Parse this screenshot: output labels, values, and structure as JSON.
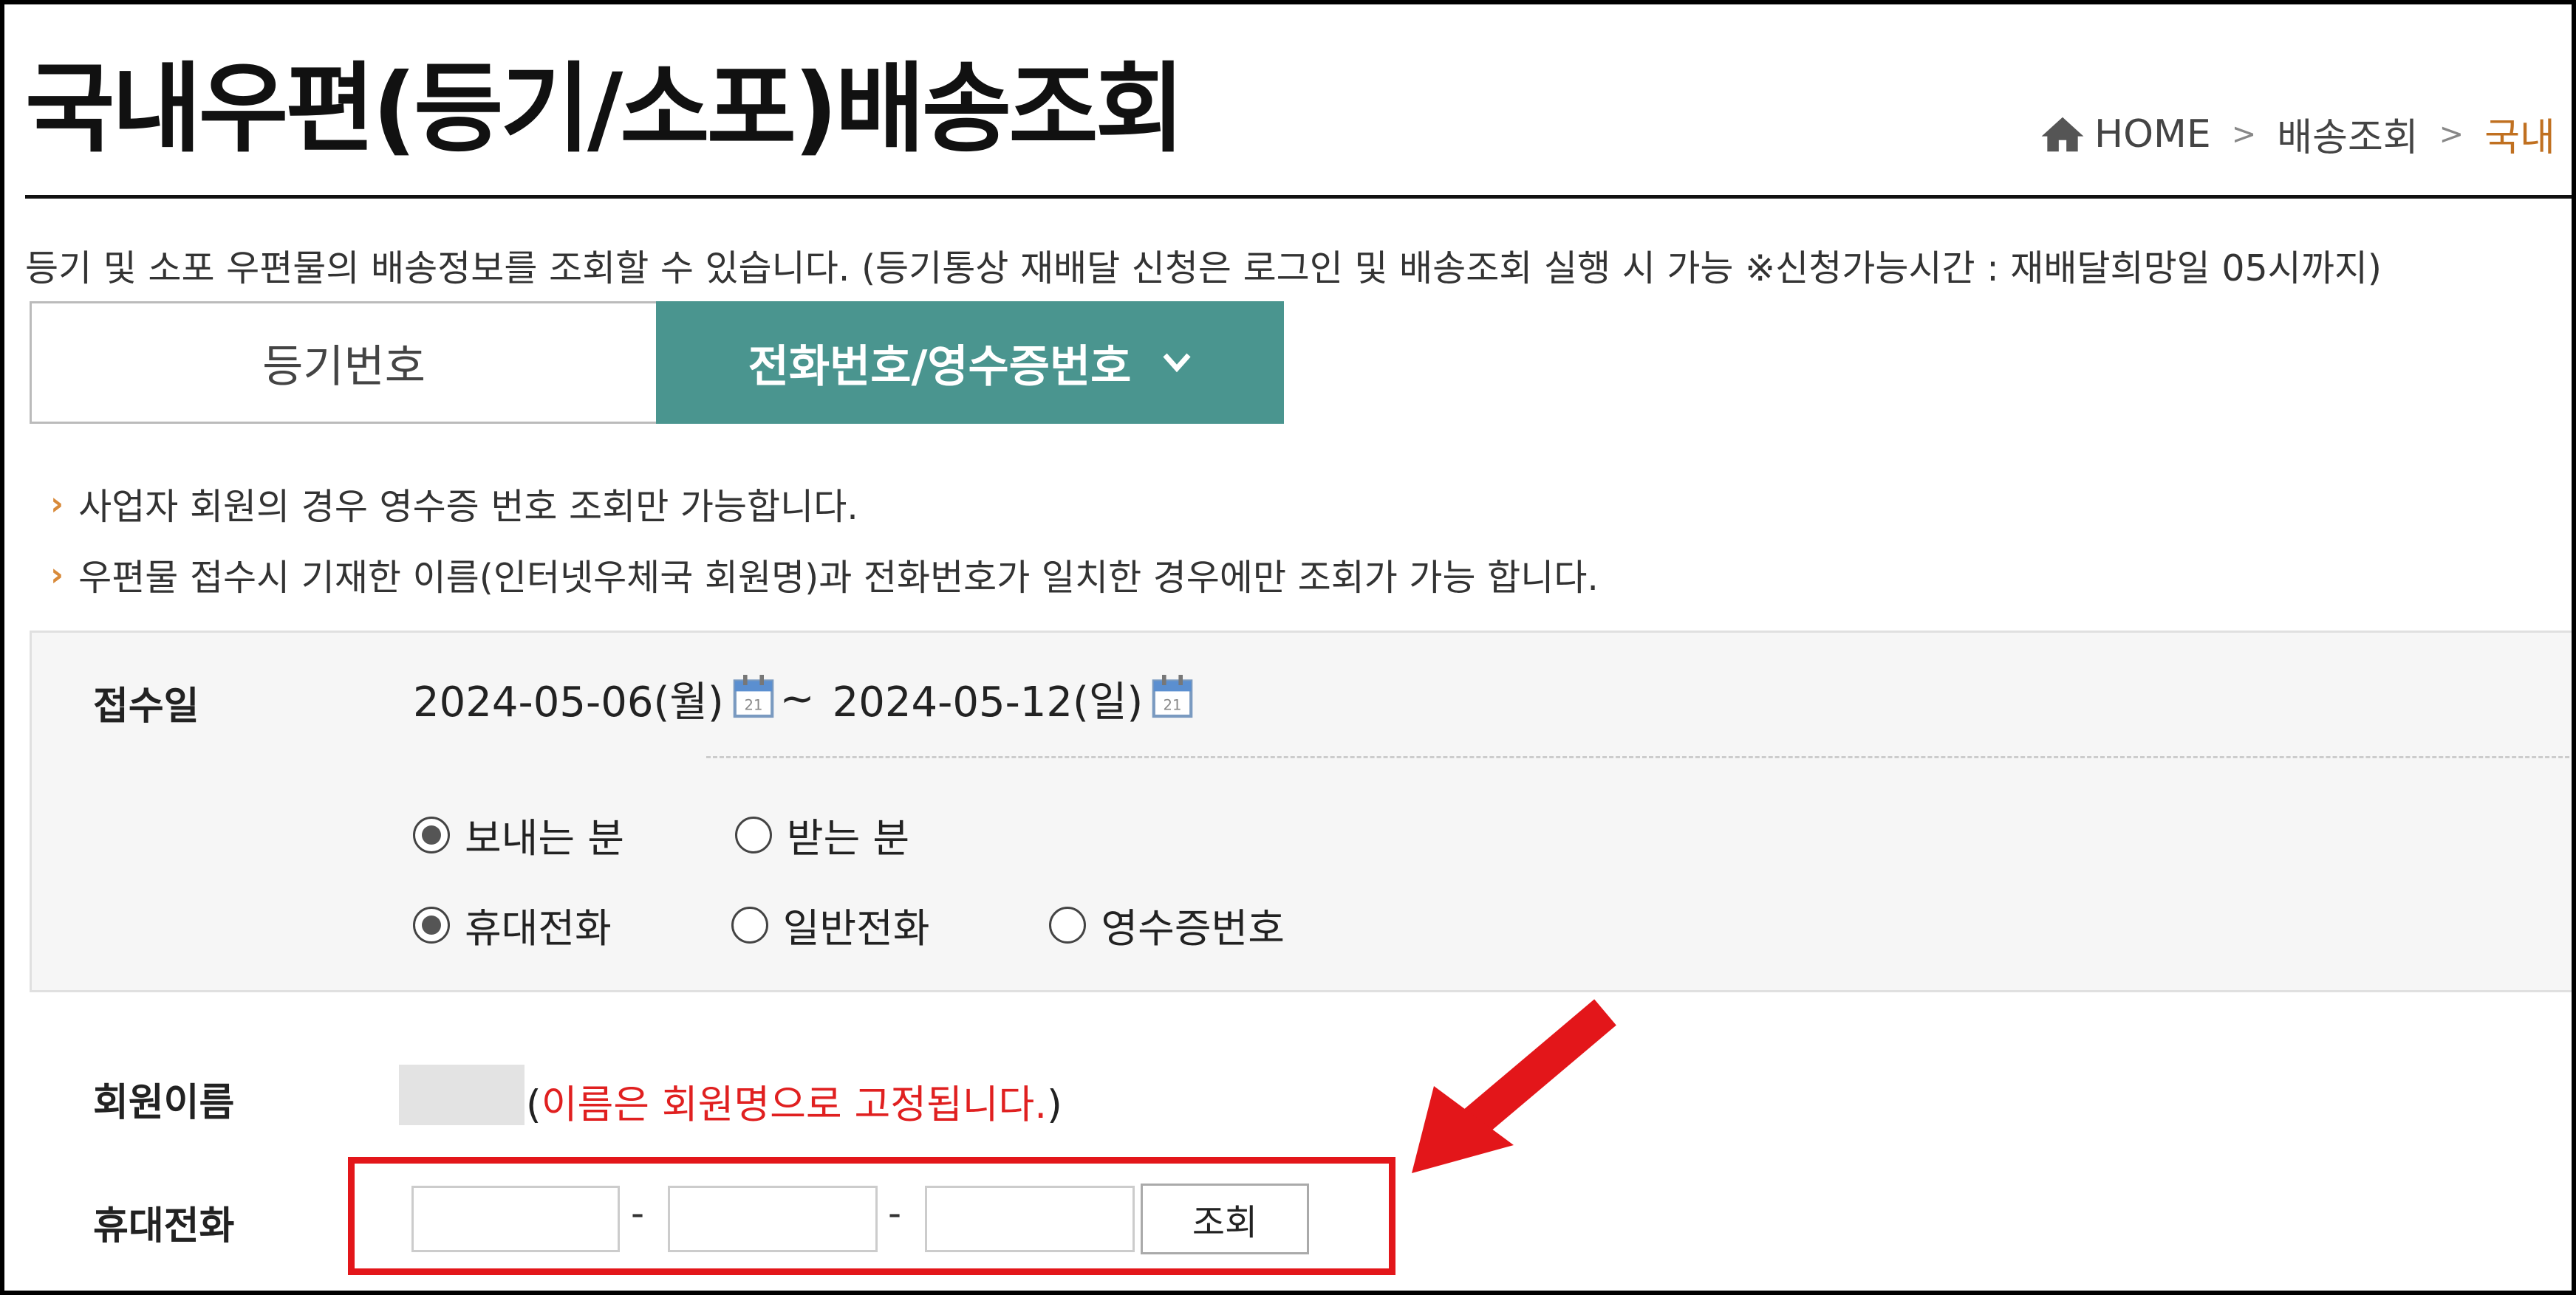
{
  "page": {
    "title": "국내우편(등기/소포)배송조회",
    "breadcrumb": [
      "HOME",
      "배송조회",
      "국내"
    ],
    "description": "등기 및 소포 우편물의 배송정보를 조회할 수 있습니다. (등기통상 재배달 신청은 로그인 및 배송조회 실행 시 가능 ※신청가능시간 : 재배달희망일 05시까지)"
  },
  "tabs": [
    {
      "label": "등기번호",
      "active": false
    },
    {
      "label": "전화번호/영수증번호",
      "active": true
    }
  ],
  "notes": [
    "사업자 회원의 경우 영수증 번호 조회만 가능합니다.",
    "우편물 접수시 기재한 이름(인터넷우체국 회원명)과 전화번호가 일치한 경우에만 조회가 가능 합니다."
  ],
  "form": {
    "date_label": "접수일",
    "date_from": "2024-05-06(월)",
    "date_tilde": "~",
    "date_to": "2024-05-12(일)",
    "sender_options": [
      {
        "label": "보내는 분",
        "checked": true
      },
      {
        "label": "받는 분",
        "checked": false
      }
    ],
    "type_options": [
      {
        "label": "휴대전화",
        "checked": true
      },
      {
        "label": "일반전화",
        "checked": false
      },
      {
        "label": "영수증번호",
        "checked": false
      }
    ],
    "member_label": "회원이름",
    "member_note_open": "(",
    "member_note_red": "이름은 회원명으로 고정됩니다.",
    "member_note_close": ")",
    "phone_label": "휴대전화",
    "phone_sep": "-",
    "phone_values": [
      "",
      "",
      ""
    ],
    "search_button": "조회"
  },
  "colors": {
    "tab_active": "#4a958f",
    "highlight": "#e3161a",
    "breadcrumb_current": "#c07020"
  }
}
